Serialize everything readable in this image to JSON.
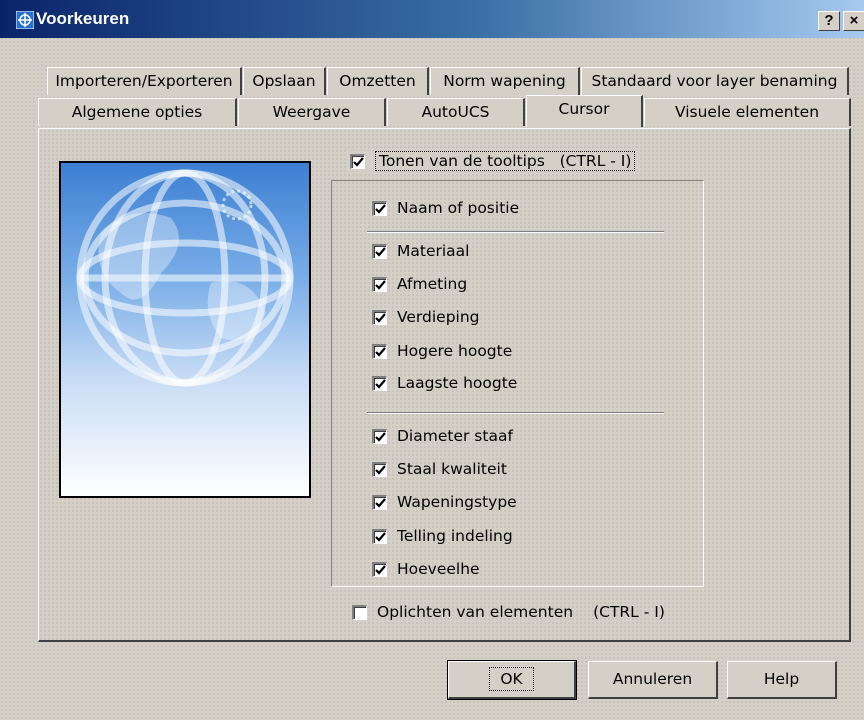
{
  "window": {
    "title": "Voorkeuren",
    "help_button": "?",
    "close_button": "×"
  },
  "tabs_back": [
    {
      "label": "Importeren/Exporteren"
    },
    {
      "label": "Opslaan"
    },
    {
      "label": "Omzetten"
    },
    {
      "label": "Norm wapening"
    },
    {
      "label": "Standaard voor layer benaming"
    }
  ],
  "tabs_front": [
    {
      "label": "Algemene opties"
    },
    {
      "label": "Weergave"
    },
    {
      "label": "AutoUCS"
    },
    {
      "label": "Cursor",
      "active": true
    },
    {
      "label": "Visuele elementen"
    }
  ],
  "tooltips": {
    "label": "Tonen van de tooltips",
    "shortcut": "(CTRL - I)",
    "checked": true,
    "items_top": [
      {
        "label": "Naam of positie",
        "checked": true
      }
    ],
    "items_mid": [
      {
        "label": "Materiaal",
        "checked": true
      },
      {
        "label": "Afmeting",
        "checked": true
      },
      {
        "label": "Verdieping",
        "checked": true
      },
      {
        "label": "Hogere hoogte",
        "checked": true
      },
      {
        "label": "Laagste hoogte",
        "checked": true
      }
    ],
    "items_bottom": [
      {
        "label": "Diameter staaf",
        "checked": true
      },
      {
        "label": "Staal kwaliteit",
        "checked": true
      },
      {
        "label": "Wapeningstype",
        "checked": true
      },
      {
        "label": "Telling indeling",
        "checked": true
      },
      {
        "label": "Hoeveelhe",
        "checked": true
      }
    ]
  },
  "highlight": {
    "label": "Oplichten van elementen",
    "shortcut": "(CTRL - I)",
    "checked": false
  },
  "buttons": {
    "ok": "OK",
    "cancel": "Annuleren",
    "help": "Help"
  }
}
